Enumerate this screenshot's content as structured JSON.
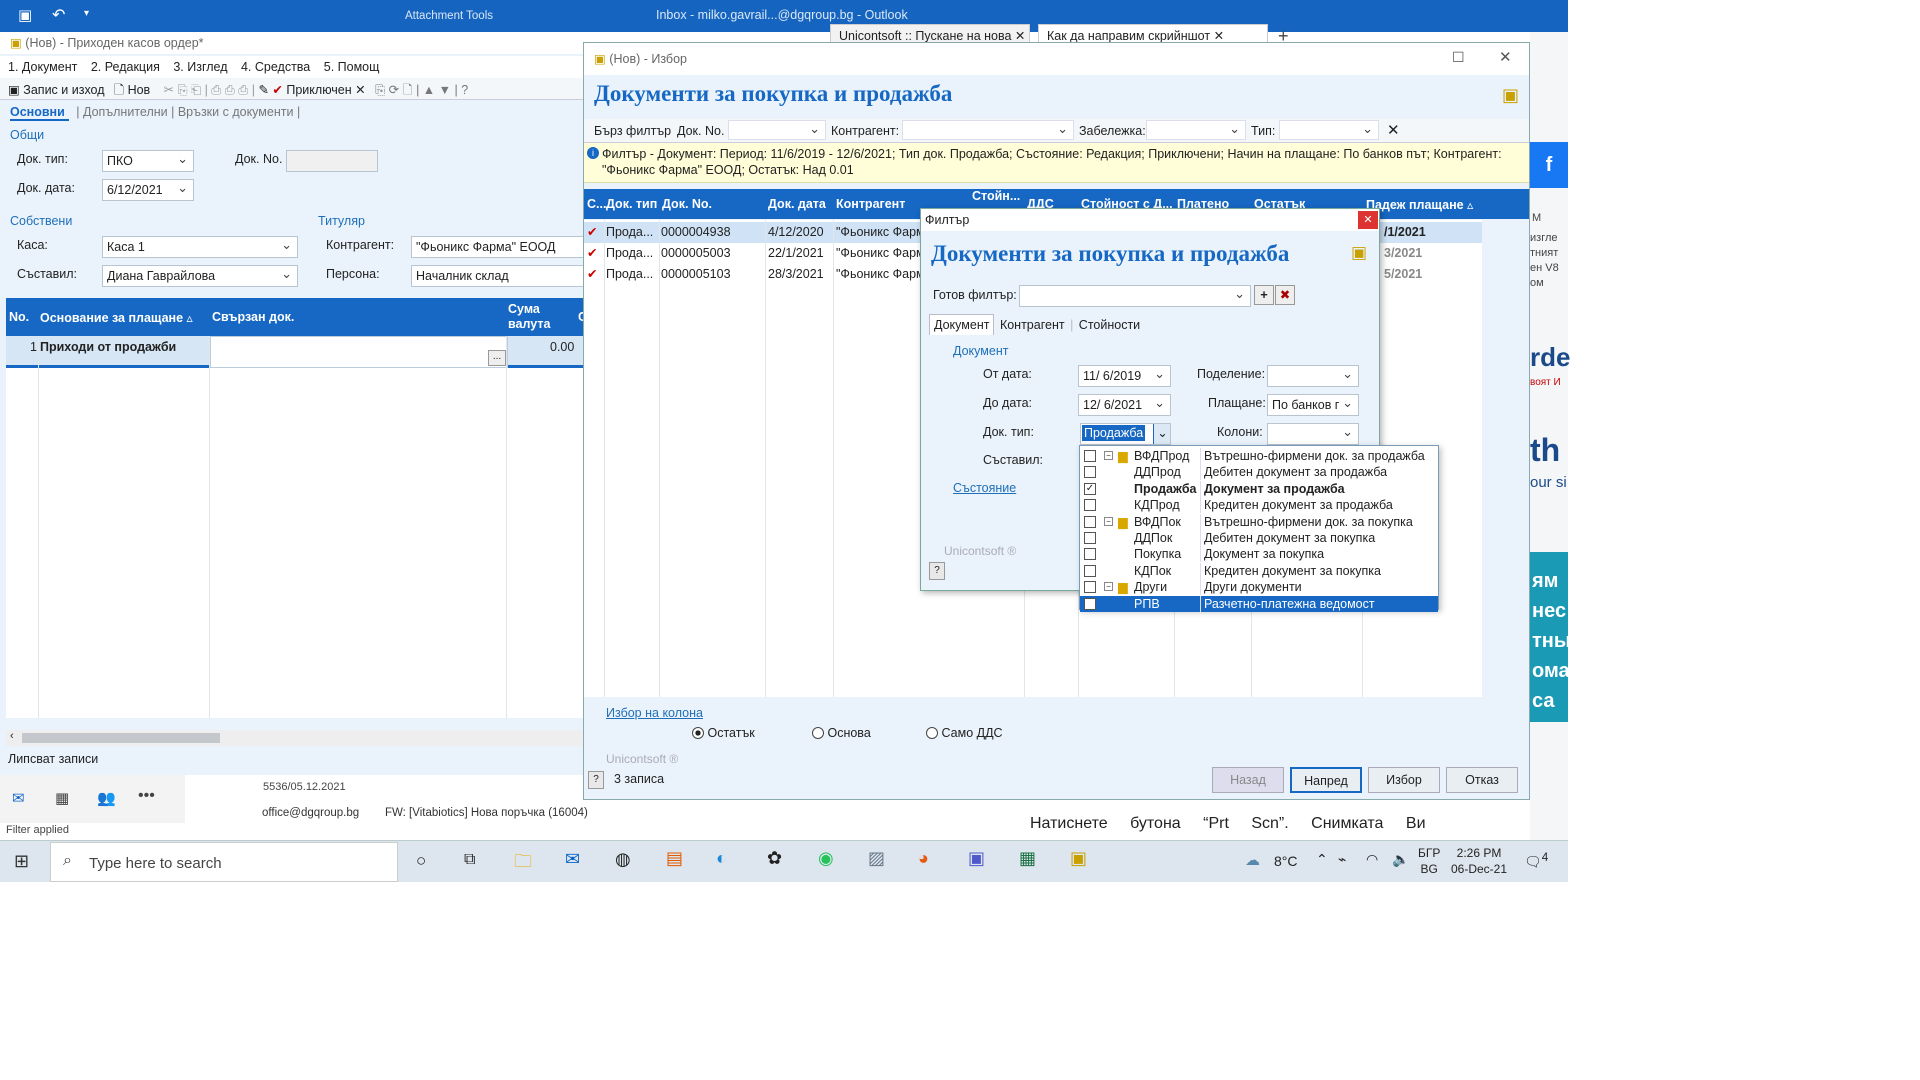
{
  "outlook": {
    "attachment_tools": "Attachment Tools",
    "inbox_title": "Inbox - milko.gavrail...@dgqroup.bg - Outlook",
    "tab1": "Unicontsoft :: Пускане на нова",
    "tab2": "Как да направим скрийншот",
    "plus": "+"
  },
  "cash": {
    "title": "(Нов) - Приходен касов ордер*",
    "menu": [
      "1. Документ",
      "2. Редакция",
      "3. Изглед",
      "4. Средства",
      "5. Помощ"
    ],
    "toolbar": {
      "save_exit": "Запис и изход",
      "new": "Нов",
      "complete": "Приключен"
    },
    "tabs": [
      "Основни",
      "Допълнителни",
      "Връзки с документи"
    ],
    "section_general": "Общи",
    "doc_type_label": "Док. тип:",
    "doc_type_value": "ПКО",
    "doc_no_label": "Док. No.",
    "doc_date_label": "Док. дата:",
    "doc_date_value": "6/12/2021",
    "section_own": "Собствени",
    "section_holder": "Титуляр",
    "cash_label": "Каса:",
    "cash_value": "Каса 1",
    "author_label": "Съставил:",
    "author_value": "Диана Гаврайлова",
    "contractor_label": "Контрагент:",
    "contractor_value": "\"Фьоникс Фарма\" ЕООД",
    "person_label": "Персона:",
    "person_value": "Началник склад",
    "grid": {
      "col_no": "No.",
      "col_reason": "Основание за плащане ▵",
      "col_linked": "Свързан док.",
      "col_amount": "Сума валута",
      "col_extra": "С",
      "row_no": "1",
      "row_reason": "Приходи от продажби",
      "row_ellipsis": "...",
      "row_amount": "0.00"
    },
    "status": "Липсват записи"
  },
  "select": {
    "title": "(Нов) - Избор",
    "header": "Документи за покупка и продажба",
    "quick_filter": "Бърз филтър",
    "doc_no": "Док. No.",
    "contractor": "Контрагент:",
    "note": "Забележка:",
    "type": "Тип:",
    "info": "Филтър - Документ: Период: 11/6/2019 - 12/6/2021; Тип док. Продажба; Състояние: Редакция; Приключени; Начин на плащане: По банков път; Контрагент: \"Фьоникс Фарма\" ЕООД; Остатък: Над 0.01",
    "columns": [
      "С...",
      "Док. тип",
      "Док. No.",
      "Док. дата",
      "Контрагент",
      "Стойн...",
      "ДДС",
      "Стойност с Д...",
      "Платено",
      "Остатък",
      "Падеж плащане ▵"
    ],
    "rows": [
      {
        "type": "Прода...",
        "no": "0000004938",
        "date": "4/12/2020",
        "contractor": "\"Фьоникс Фарм",
        "due": "/1/2021"
      },
      {
        "type": "Прода...",
        "no": "0000005003",
        "date": "22/1/2021",
        "contractor": "\"Фьоникс Фарм",
        "due": "3/2021"
      },
      {
        "type": "Прода...",
        "no": "0000005103",
        "date": "28/3/2021",
        "contractor": "\"Фьоникс Фарм",
        "due": "5/2021"
      }
    ],
    "col_choice": "Избор на колона",
    "radios": [
      "Остатък",
      "Основа",
      "Само ДДС"
    ],
    "brand": "Unicontsoft ®",
    "records": "3 записа",
    "buttons": {
      "back": "Назад",
      "next": "Напред",
      "choose": "Избор",
      "cancel": "Отказ"
    }
  },
  "filter": {
    "title": "Филтър",
    "header": "Документи за покупка и продажба",
    "ready_filter": "Готов филтър:",
    "tabs": [
      "Документ",
      "Контрагент",
      "Стойности"
    ],
    "section_doc": "Документ",
    "from_label": "От дата:",
    "from_value": "11/ 6/2019",
    "to_label": "До дата:",
    "to_value": "12/ 6/2021",
    "doctype_label": "Док. тип:",
    "doctype_value": "Продажба",
    "author_label": "Съставил:",
    "division_label": "Поделение:",
    "payment_label": "Плащане:",
    "payment_value": "По банков г",
    "columns_label": "Колони:",
    "section_state": "Състояние",
    "brand": "Unicontsoft ®",
    "list": [
      {
        "code": "ВФДПрод",
        "name": "Вътрешно-фирмени док. за продажба",
        "group": true,
        "checked": false
      },
      {
        "code": "ДДПрод",
        "name": "Дебитен документ за продажба",
        "group": false,
        "checked": false
      },
      {
        "code": "Продажба",
        "name": "Документ за продажба",
        "group": false,
        "checked": true
      },
      {
        "code": "КДПрод",
        "name": "Кредитен документ за продажба",
        "group": false,
        "checked": false
      },
      {
        "code": "ВФДПок",
        "name": "Вътрешно-фирмени док. за покупка",
        "group": true,
        "checked": false
      },
      {
        "code": "ДДПок",
        "name": "Дебитен документ за покупка",
        "group": false,
        "checked": false
      },
      {
        "code": "Покупка",
        "name": "Документ за покупка",
        "group": false,
        "checked": false
      },
      {
        "code": "КДПок",
        "name": "Кредитен документ за покупка",
        "group": false,
        "checked": false
      },
      {
        "code": "Други",
        "name": "Други документи",
        "group": true,
        "checked": false
      },
      {
        "code": "РПВ",
        "name": "Разчетно-платежна ведомост",
        "group": false,
        "checked": false
      }
    ]
  },
  "background": {
    "email_line1": "5536/05.12.2021",
    "email_from": "office@dgqroup.bg",
    "email_subject": "FW: [Vitabiotics] Нова поръчка (16004)",
    "filter_applied": "Filter applied",
    "bottom_text": [
      "Натиснете",
      "бутона",
      "“Prt",
      "Scn”.",
      "Снимката",
      "Ви"
    ],
    "right_snips": [
      "М",
      "изгле",
      "тният",
      "ен V8",
      "ом",
      "rde",
      "воят И",
      "th",
      "our si",
      "ям",
      "нес",
      "тны",
      "ома",
      "са"
    ]
  },
  "taskbar": {
    "search_placeholder": "Type here to search",
    "temp": "8°C",
    "lang1": "БГР",
    "lang2": "BG",
    "time": "2:26 PM",
    "date": "06-Dec-21",
    "notif": "4"
  },
  "colors": {
    "accent": "#1668c4",
    "title_blue": "#1565c0",
    "info_bg": "#fffed8"
  }
}
